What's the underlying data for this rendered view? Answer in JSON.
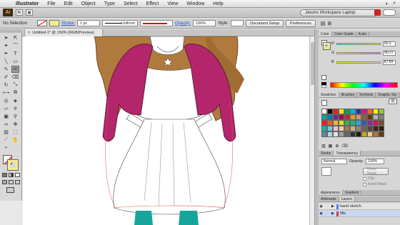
{
  "menubar": {
    "apple": "",
    "app": "Illustrator",
    "items": [
      "File",
      "Edit",
      "Object",
      "Type",
      "Select",
      "Effect",
      "View",
      "Window",
      "Help"
    ]
  },
  "appbar": {
    "logo": "Ai",
    "workspace": "Jasons Workspace Laptop"
  },
  "control": {
    "selection": "No Selection",
    "stroke_label": "Stroke:",
    "stroke_weight": "1 pt",
    "profile": "Uniform",
    "opacity_label": "Opacity:",
    "opacity_value": "100%",
    "style_label": "Style:",
    "doc_setup": "Document Setup",
    "preferences": "Preferences"
  },
  "document": {
    "tab_title": "Untitled-1* @ 150% (RGB/Preview)"
  },
  "color_panel": {
    "tabs": [
      "Color",
      "Color Guide",
      "Kuler"
    ],
    "rows": [
      {
        "label": "R",
        "value": "82.2"
      },
      {
        "label": "G",
        "value": "80.27"
      },
      {
        "label": "B",
        "value": "87.84"
      }
    ]
  },
  "swatches_panel": {
    "tabs": [
      "Swatches",
      "Brushes",
      "Symbols",
      "Graphic Sty"
    ],
    "colors": [
      "#ffffff",
      "#000000",
      "#e2231a",
      "#f7e600",
      "#00a650",
      "#00aeef",
      "#2e3192",
      "#ec008c",
      "#f26522",
      "#fff200",
      "#8dc63f",
      "#00a99d",
      "#0072bc",
      "#662d91",
      "#9e005d",
      "#c1272d",
      "#f7941d",
      "#c69c6d",
      "#8c6239",
      "#603913",
      "#b3b3b3",
      "#808080",
      "#ed1c24",
      "#f15a24",
      "#fbb03b",
      "#d9e021",
      "#39b54a",
      "#22b573",
      "#29abe2",
      "#3f51b5",
      "#92278f",
      "#d4145a",
      "#754c24",
      "#1bb2a6",
      "#7ec3e0",
      "#e1c2da",
      "#f5c6a5",
      "#a67c52",
      "#c7b299",
      "#998675",
      "#736357",
      "#534741",
      "#3c2415",
      "#2d1f11",
      "#4a90a4",
      "#a8d8e8",
      "#e0e0e0",
      "#9f9f9f",
      "#666666",
      "#333333",
      "#1a1a1a",
      "#d4a017",
      "#e9cf7a",
      "#b87333",
      "#5a3e1b"
    ]
  },
  "transparency_panel": {
    "tabs": [
      "Stroke",
      "Transparency"
    ],
    "mode": "Normal",
    "opacity_label": "Opacity:",
    "opacity_value": "100%",
    "make_mask": "Make Mask",
    "clip": "Clip",
    "invert_mask": "Invert Mask"
  },
  "appearance_tabs": [
    "Appearance",
    "Gradient"
  ],
  "layers_panel": {
    "tabs": [
      "Artboards",
      "Layers"
    ],
    "layers": [
      {
        "name": "hand sketch",
        "color": "#4f7cff"
      },
      {
        "name": "fills",
        "color": "#e03a3a"
      }
    ]
  }
}
